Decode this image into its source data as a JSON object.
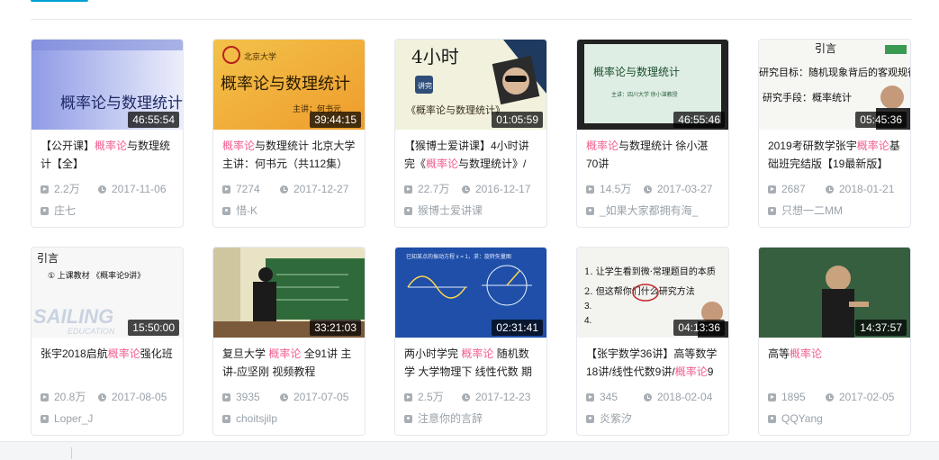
{
  "videos": [
    {
      "duration": "46:55:54",
      "title_parts": [
        {
          "t": "【公开课】"
        },
        {
          "t": "概率论",
          "hl": true
        },
        {
          "t": "与数理统计【全】"
        }
      ],
      "views": "2.2万",
      "date": "2017-11-06",
      "uploader": "庄七",
      "thumb_text": [
        "概率论与数理统计"
      ]
    },
    {
      "duration": "39:44:15",
      "title_parts": [
        {
          "t": "概率论",
          "hl": true
        },
        {
          "t": "与数理统计 北京大学 主讲：何书元（共112集）"
        }
      ],
      "views": "7274",
      "date": "2017-12-27",
      "uploader": "惜-K",
      "thumb_text": [
        "北京大学",
        "概率论与数理统计",
        "主讲：何书元"
      ]
    },
    {
      "duration": "01:05:59",
      "title_parts": [
        {
          "t": "【猴博士爱讲课】4小时讲完《"
        },
        {
          "t": "概率论",
          "hl": true
        },
        {
          "t": "与数理统计》/"
        }
      ],
      "views": "22.7万",
      "date": "2016-12-17",
      "uploader": "猴博士爱讲课",
      "thumb_text": [
        "4小时",
        "讲完",
        "《概率论与数理统计》"
      ]
    },
    {
      "duration": "46:55:46",
      "title_parts": [
        {
          "t": "概率论",
          "hl": true
        },
        {
          "t": "与数理统计 徐小湛 70讲"
        }
      ],
      "views": "14.5万",
      "date": "2017-03-27",
      "uploader": "_如果大家都拥有海_",
      "thumb_text": [
        "概率论与数理统计",
        "主讲：四川大学 徐小湛教授"
      ]
    },
    {
      "duration": "05:45:36",
      "title_parts": [
        {
          "t": "2019考研数学张宇"
        },
        {
          "t": "概率论",
          "hl": true
        },
        {
          "t": "基础班完结版【19最新版】"
        }
      ],
      "views": "2687",
      "date": "2018-01-21",
      "uploader": "只想一二MM",
      "thumb_text": [
        "引言",
        "研究目标：随机现象背后的客观规律",
        "研究手段：概率统计"
      ]
    },
    {
      "duration": "15:50:00",
      "title_parts": [
        {
          "t": "张宇2018启航"
        },
        {
          "t": "概率论",
          "hl": true
        },
        {
          "t": "强化班"
        }
      ],
      "views": "20.8万",
      "date": "2017-08-05",
      "uploader": "Loper_J",
      "thumb_text": [
        "引言",
        "① 上课教材 《概率论9讲》",
        "SAILING",
        "EDUCATION"
      ]
    },
    {
      "duration": "33:21:03",
      "title_parts": [
        {
          "t": "复旦大学 "
        },
        {
          "t": "概率论",
          "hl": true
        },
        {
          "t": " 全91讲 主讲-应坚刚 视频教程"
        }
      ],
      "views": "3935",
      "date": "2017-07-05",
      "uploader": "choitsjilp",
      "thumb_text": []
    },
    {
      "duration": "02:31:41",
      "title_parts": [
        {
          "t": "两小时学完 "
        },
        {
          "t": "概率论",
          "hl": true
        },
        {
          "t": " 随机数学 大学物理下 线性代数 期"
        }
      ],
      "views": "2.5万",
      "date": "2017-12-23",
      "uploader": "注意你的言辞",
      "thumb_text": [
        "已知某点的振动方程 x = 1，求：旋转矢量图"
      ]
    },
    {
      "duration": "04:13:36",
      "title_parts": [
        {
          "t": "【张宇数学36讲】高等数学18讲/线性代数9讲/"
        },
        {
          "t": "概率论",
          "hl": true
        },
        {
          "t": "9"
        }
      ],
      "views": "345",
      "date": "2018-02-04",
      "uploader": "炎紫汐",
      "thumb_text": [
        "1. 让学生看到微·常理题目的本质",
        "2. 但这帮你们什么研究方法",
        "3.",
        "4."
      ]
    },
    {
      "duration": "14:37:57",
      "title_parts": [
        {
          "t": "高等"
        },
        {
          "t": "概率论",
          "hl": true
        }
      ],
      "views": "1895",
      "date": "2017-02-05",
      "uploader": "QQYang",
      "thumb_text": []
    }
  ],
  "colors": {
    "accent": "#00a1d6",
    "highlight": "#f25d8e",
    "meta": "#99a2aa"
  }
}
